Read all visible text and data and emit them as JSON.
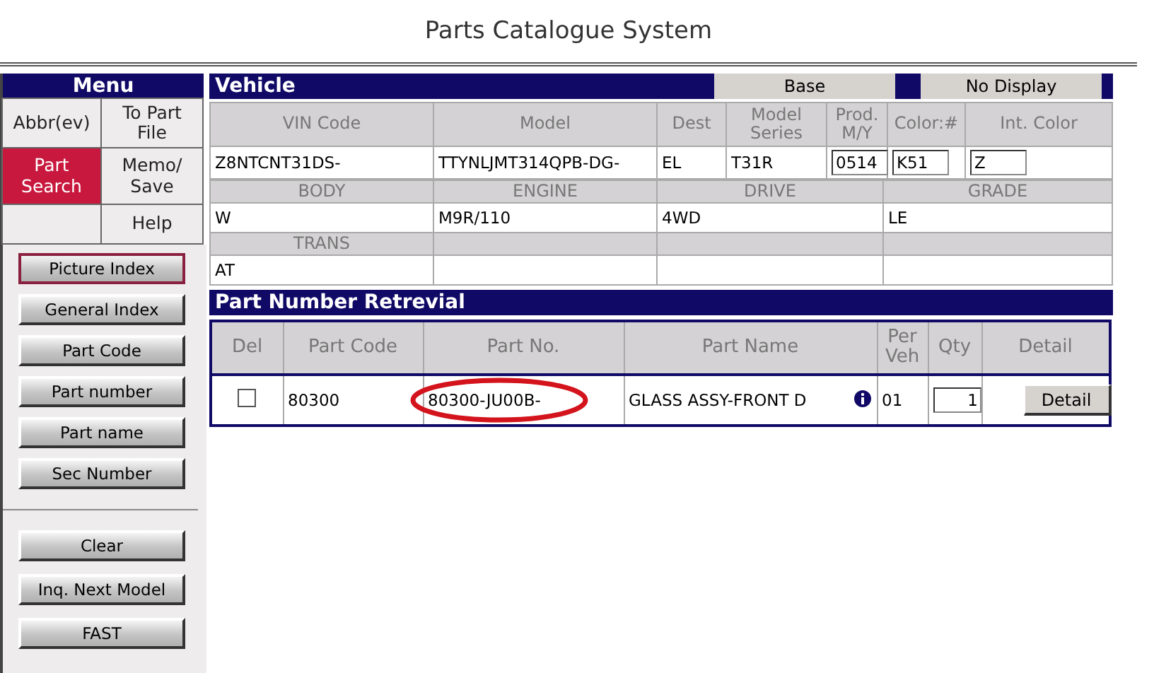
{
  "title": "Parts Catalogue System",
  "menu": {
    "title": "Menu",
    "items": [
      {
        "label": "Abbr(ev)",
        "selected": false
      },
      {
        "label": "To Part File",
        "selected": false
      },
      {
        "label": "Part Search",
        "selected": true
      },
      {
        "label": "Memo/ Save",
        "selected": false
      },
      {
        "label": "Help",
        "selected": false
      }
    ]
  },
  "search_buttons": [
    {
      "label": "Picture Index",
      "selected": true
    },
    {
      "label": "General Index",
      "selected": false
    },
    {
      "label": "Part Code",
      "selected": false
    },
    {
      "label": "Part number",
      "selected": false
    },
    {
      "label": "Part name",
      "selected": false
    },
    {
      "label": "Sec Number",
      "selected": false
    }
  ],
  "action_buttons": [
    "Clear",
    "Inq. Next Model",
    "FAST"
  ],
  "vehicle": {
    "title": "Vehicle",
    "tabs": [
      "Base",
      "No Display"
    ],
    "columns": [
      {
        "label": "VIN Code",
        "value": "Z8NTCNT31DS-",
        "kind": "text"
      },
      {
        "label": "Model",
        "value": "TTYNLJMT314QPB-DG-",
        "kind": "text"
      },
      {
        "label": "Dest",
        "value": "EL",
        "kind": "text"
      },
      {
        "label": "Model Series",
        "value": "T31R",
        "kind": "text"
      },
      {
        "label": "Prod. M/Y",
        "value": "0514",
        "kind": "input"
      },
      {
        "label": "Color:#",
        "value": "K51",
        "kind": "input"
      },
      {
        "label": "Int. Color",
        "value": "Z",
        "kind": "input"
      }
    ],
    "spec_rows": [
      [
        {
          "label": "BODY",
          "value": "W"
        },
        {
          "label": "ENGINE",
          "value": "M9R/110"
        },
        {
          "label": "DRIVE",
          "value": "4WD"
        },
        {
          "label": "GRADE",
          "value": "LE"
        }
      ],
      [
        {
          "label": "TRANS",
          "value": "AT"
        }
      ]
    ]
  },
  "parts": {
    "title": "Part Number Retrevial",
    "columns": [
      "Del",
      "Part Code",
      "Part No.",
      "Part Name",
      "Per Veh",
      "Qty",
      "Detail"
    ],
    "rows": [
      {
        "checked": false,
        "part_code": "80300",
        "part_no": "80300-JU00B-",
        "circled": true,
        "part_name": "GLASS ASSY-FRONT D",
        "per_veh": "01",
        "qty": "1",
        "detail": "Detail"
      }
    ]
  }
}
